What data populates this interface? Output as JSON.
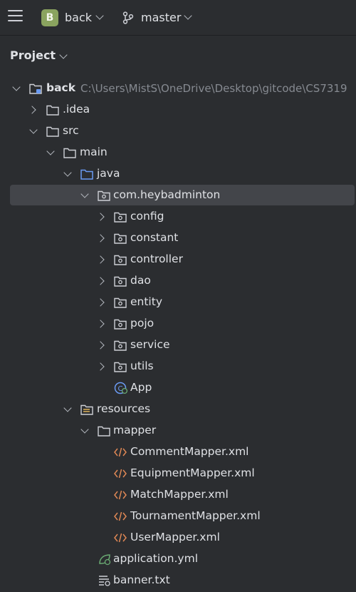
{
  "topbar": {
    "project_initial": "B",
    "project_name": "back",
    "branch_name": "master"
  },
  "panel": {
    "title": "Project"
  },
  "tree": {
    "root_label": "back",
    "root_path": "C:\\Users\\MistS\\OneDrive\\Desktop\\gitcode\\CS7319",
    "idea": ".idea",
    "src": "src",
    "main": "main",
    "java": "java",
    "package": "com.heybadminton",
    "config": "config",
    "constant": "constant",
    "controller": "controller",
    "dao": "dao",
    "entity": "entity",
    "pojo": "pojo",
    "service": "service",
    "utils": "utils",
    "app": "App",
    "resources": "resources",
    "mapper": "mapper",
    "comment_mapper": "CommentMapper.xml",
    "equipment_mapper": "EquipmentMapper.xml",
    "match_mapper": "MatchMapper.xml",
    "tournament_mapper": "TournamentMapper.xml",
    "user_mapper": "UserMapper.xml",
    "application_yml": "application.yml",
    "banner": "banner.txt"
  },
  "colors": {
    "background": "#2b2d30",
    "selection": "#43454a",
    "text": "#dfe1e5",
    "muted": "#868a91",
    "project_badge": "#8aa35f",
    "xml_icon": "#e08855",
    "java_folder": "#6b9bf4",
    "spring_green": "#6aab73"
  }
}
